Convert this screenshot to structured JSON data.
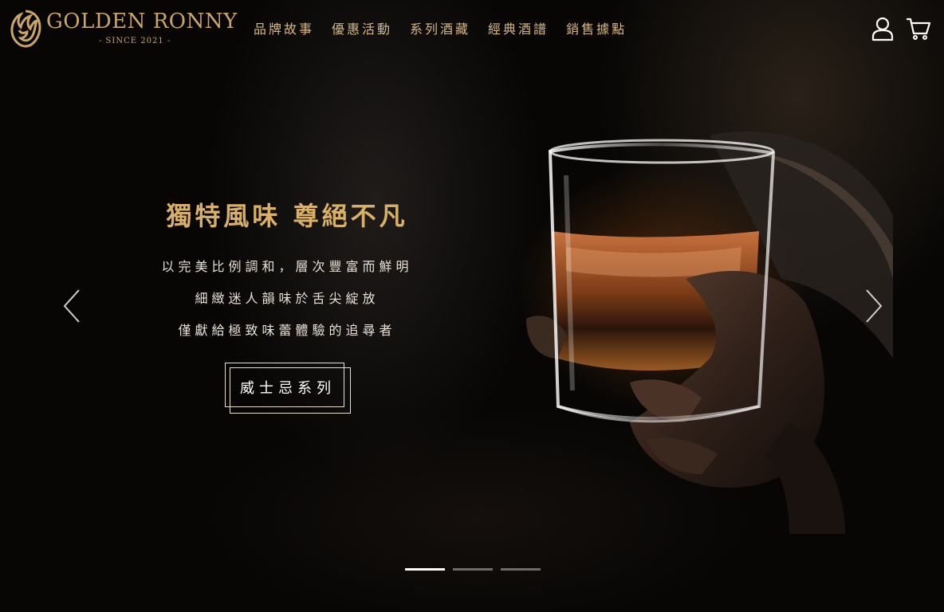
{
  "brand": {
    "name": "GOLDEN RONNY",
    "since": "- SINCE  2021 -"
  },
  "nav": {
    "items": [
      {
        "label": "品牌故事"
      },
      {
        "label": "優惠活動"
      },
      {
        "label": "系列酒藏"
      },
      {
        "label": "經典酒譜"
      },
      {
        "label": "銷售據點"
      }
    ]
  },
  "header_icons": [
    "user-icon",
    "cart-icon"
  ],
  "hero": {
    "title": "獨特風味 尊絕不凡",
    "lines": [
      "以完美比例調和，層次豐富而鮮明",
      "細緻迷人韻味於舌尖綻放",
      "僅獻給極致味蕾體驗的追尋者"
    ],
    "cta_label": "威士忌系列"
  },
  "carousel": {
    "slide_count": 3,
    "active_index": 0,
    "prev_icon": "chevron-left-icon",
    "next_icon": "chevron-right-icon"
  },
  "colors": {
    "gold": "#c9a567",
    "title_gold": "#d8b068",
    "text_light": "#e8e0d4",
    "background": "#070605",
    "dot_inactive": "#6c6c6c",
    "dot_active": "#ffffff"
  }
}
